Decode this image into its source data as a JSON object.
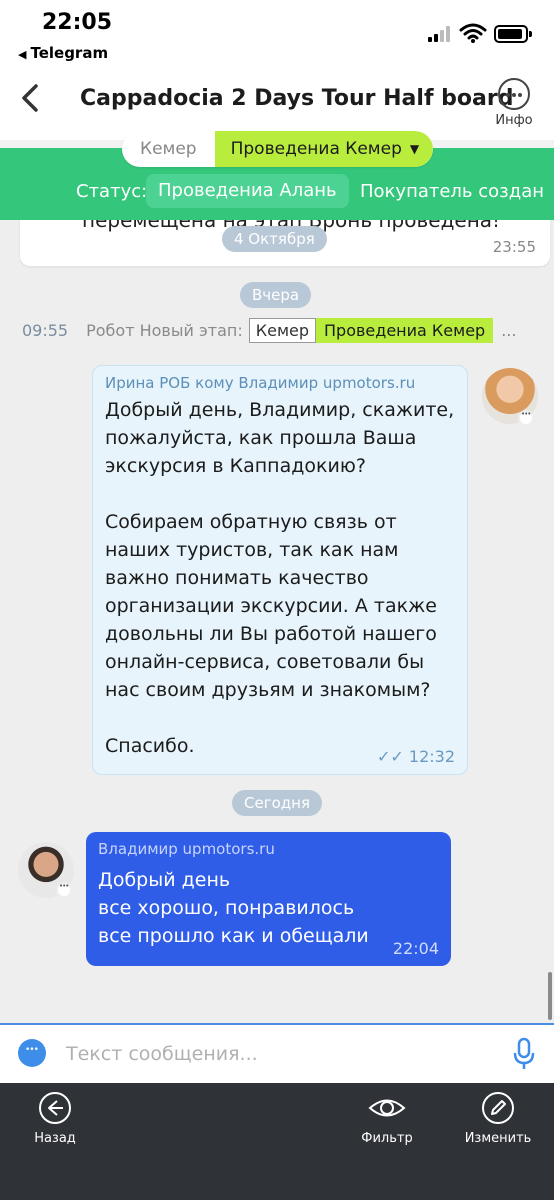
{
  "status_bar": {
    "time": "22:05",
    "back_app": "Telegram"
  },
  "nav": {
    "title": "Cappadocia 2 Days Tour Half board",
    "info_label": "Инфо"
  },
  "stage": {
    "previous": "Кемер",
    "current": "Проведениа Кемер"
  },
  "status": {
    "label": "Статус:",
    "value": "Проведениа Алань",
    "buyer_text": "Покупатель создан"
  },
  "chat": {
    "prev_message": {
      "text": "перемещена на этап Бронь проведена!",
      "time": "23:55"
    },
    "dates": {
      "oct4": "4 Октября",
      "yesterday": "Вчера",
      "today": "Сегодня"
    },
    "system_event": {
      "time": "09:55",
      "text": "Робот Новый этап:",
      "old_stage": "Кемер",
      "new_stage": "Проведениа Кемер",
      "more": "..."
    },
    "incoming": {
      "header": "Ирина РОБ кому Владимир upmotors.ru",
      "body": "Добрый день, Владимир, скажите, пожалуйста, как прошла Ваша экскурсия в Каппадокию?\n\nСобираем обратную связь от наших туристов, так как нам важно понимать качество организации экскурсии. А также довольны ли Вы работой нашего онлайн-сервиса, советовали бы нас своим друзьям и знакомым?\n\nСпасибо.",
      "time": "12:32"
    },
    "outgoing": {
      "header": "Владимир upmotors.ru",
      "body": "Добрый день\nвсе хорошо, понравилось\nвсе прошло как и обещали",
      "time": "22:04"
    }
  },
  "input": {
    "placeholder": "Текст сообщения..."
  },
  "toolbar": {
    "back": "Назад",
    "filter": "Фильтр",
    "edit": "Изменить"
  },
  "colors": {
    "green": "#34c77b",
    "lime": "#b8ec3d",
    "incoming_bubble": "#e7f4fb",
    "outgoing_bubble": "#2f5de8",
    "toolbar": "#2f3338"
  }
}
